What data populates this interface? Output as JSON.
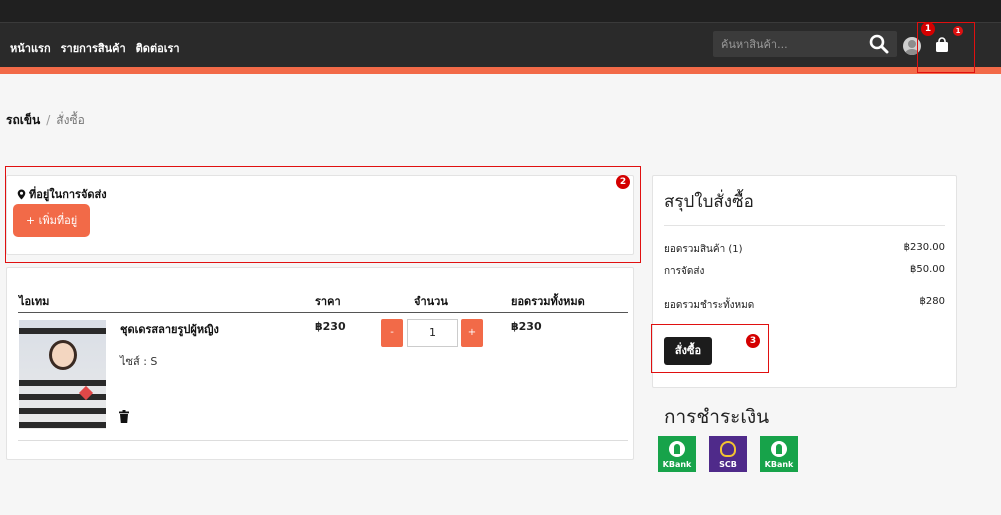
{
  "nav": {
    "items": [
      "หน้าแรก",
      "รายการสินค้า",
      "ติดต่อเรา"
    ],
    "search_placeholder": "ค้นหาสินค้า...",
    "cart_count": "1"
  },
  "markers": [
    "1",
    "2",
    "3"
  ],
  "breadcrumb": {
    "home": "รถเข็น",
    "sep": "/",
    "current": "สั่งซื้อ"
  },
  "address": {
    "title": "ที่อยู่ในการจัดส่ง",
    "add_button": "+ เพิ่มที่อยู่"
  },
  "cart_table": {
    "headers": {
      "item": "ไอเทม",
      "price": "ราคา",
      "qty": "จำนวน",
      "total": "ยอดรวมทั้งหมด"
    },
    "rows": [
      {
        "name": "ชุดเดรสลายรูปผู้หญิง",
        "variant": "ไซส์ : S",
        "price": "฿230",
        "qty": "1",
        "total": "฿230",
        "minus": "-",
        "plus": "+"
      }
    ]
  },
  "summary": {
    "title": "สรุปใบสั่งซื้อ",
    "rows": [
      {
        "label": "ยอดรวมสินค้า (1)",
        "value": "฿230.00"
      },
      {
        "label": "การจัดส่ง",
        "value": "฿50.00"
      },
      {
        "label": "ยอดรวมชำระทั้งหมด",
        "value": "฿280"
      }
    ],
    "order_button": "สั่งซื้อ"
  },
  "payment": {
    "title": "การชำระเงิน",
    "methods": [
      {
        "name": "KBank",
        "color": "#17a34a"
      },
      {
        "name": "SCB",
        "color": "#4f2a8a"
      },
      {
        "name": "KBank",
        "color": "#17a34a"
      }
    ]
  },
  "colors": {
    "accent": "#f26a48",
    "navbar": "#2a2a2a",
    "annotation": "#e01010"
  }
}
